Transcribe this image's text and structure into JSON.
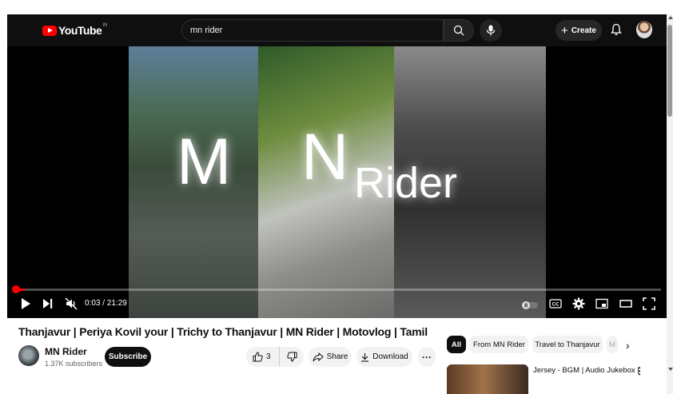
{
  "header": {
    "logo_text": "YouTube",
    "logo_country": "IN",
    "search_value": "mn rider",
    "create_label": "Create"
  },
  "player": {
    "overlay_text": {
      "m": "M",
      "n": "N",
      "rider": "Rider"
    },
    "time_display": "0:03 / 21:29",
    "progress_fraction": 0.0023
  },
  "video": {
    "title": "Thanjavur | Periya Kovil your | Trichy to Thanjavur | MN Rider | Motovlog | Tamil",
    "channel_name": "MN Rider",
    "channel_subscribers": "1.37K subscribers",
    "subscribe_label": "Subscribe",
    "like_count": "3",
    "share_label": "Share",
    "download_label": "Download"
  },
  "sidebar": {
    "chips": [
      {
        "label": "All",
        "active": true
      },
      {
        "label": "From MN Rider",
        "active": false
      },
      {
        "label": "Travel to Thanjavur",
        "active": false
      },
      {
        "label": "M",
        "active": false
      }
    ],
    "recommendation": {
      "title": "Jersey - BGM | Audio Jukebox |"
    }
  },
  "colors": {
    "brand_red": "#ff0000",
    "topbar_bg": "#0f0f0f",
    "chip_active_bg": "#0f0f0f",
    "pill_bg": "#f2f2f2"
  }
}
